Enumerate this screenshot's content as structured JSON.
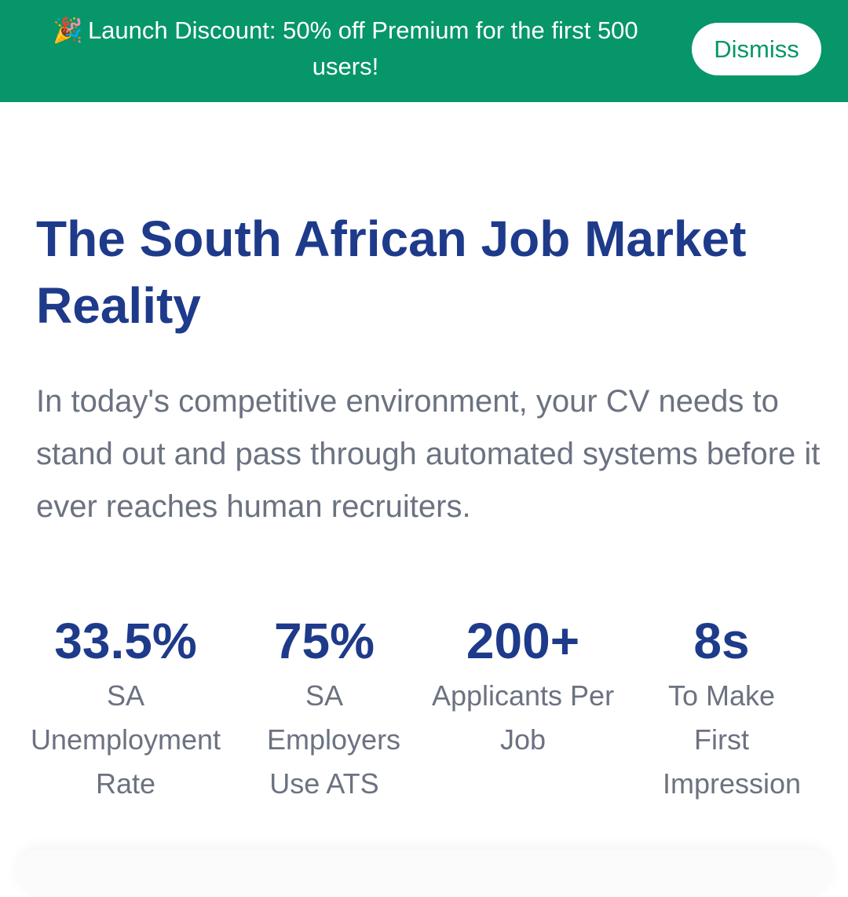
{
  "banner": {
    "emoji": "🎉",
    "text": "Launch Discount: 50% off Premium for the first 500 users!",
    "dismiss_label": "Dismiss",
    "background_color": "#069669"
  },
  "hero": {
    "title": "The South African Job Market Reality",
    "description": "In today's competitive environment, your CV needs to stand out and pass through automated systems before it ever reaches human recruiters."
  },
  "stats": [
    {
      "value": "33.5%",
      "label": "SA Unemployment Rate"
    },
    {
      "value": "75%",
      "label": "SA Employers Use ATS"
    },
    {
      "value": "200+",
      "label": "Applicants Per Job"
    },
    {
      "value": "8s",
      "label": "To Make First Impression"
    }
  ],
  "colors": {
    "heading": "#1e3a8a",
    "body_text": "#6b7280",
    "accent": "#069669"
  }
}
